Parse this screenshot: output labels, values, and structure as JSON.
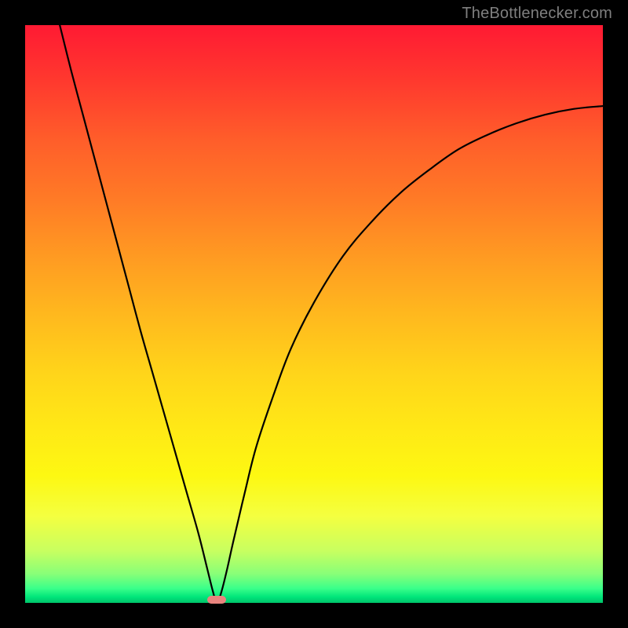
{
  "watermark": "TheBottlenecker.com",
  "colors": {
    "frame": "#000000",
    "watermark": "#7f7f7f",
    "curve": "#000000",
    "marker": "#e8847e",
    "gradient_stops": [
      {
        "pct": 0,
        "hex": "#ff1a33"
      },
      {
        "pct": 10,
        "hex": "#ff3a2e"
      },
      {
        "pct": 20,
        "hex": "#ff5e2a"
      },
      {
        "pct": 30,
        "hex": "#ff7a26"
      },
      {
        "pct": 40,
        "hex": "#ff9a22"
      },
      {
        "pct": 50,
        "hex": "#ffb81e"
      },
      {
        "pct": 60,
        "hex": "#ffd41a"
      },
      {
        "pct": 70,
        "hex": "#ffe916"
      },
      {
        "pct": 78,
        "hex": "#fdf812"
      },
      {
        "pct": 85,
        "hex": "#f4ff40"
      },
      {
        "pct": 91,
        "hex": "#c8ff60"
      },
      {
        "pct": 95,
        "hex": "#88ff78"
      },
      {
        "pct": 97.5,
        "hex": "#3aff8a"
      },
      {
        "pct": 99,
        "hex": "#00e57a"
      },
      {
        "pct": 100,
        "hex": "#00c46a"
      }
    ]
  },
  "chart_data": {
    "type": "line",
    "title": "",
    "xlabel": "",
    "ylabel": "",
    "xlim": [
      0,
      100
    ],
    "ylim": [
      0,
      100
    ],
    "marker": {
      "x": 33.2,
      "y": 0.5
    },
    "series": [
      {
        "name": "bottleneck-curve",
        "points": [
          {
            "x": 6.0,
            "y": 100.0
          },
          {
            "x": 8.0,
            "y": 92.0
          },
          {
            "x": 10.0,
            "y": 84.5
          },
          {
            "x": 12.0,
            "y": 77.0
          },
          {
            "x": 14.0,
            "y": 69.5
          },
          {
            "x": 16.0,
            "y": 62.0
          },
          {
            "x": 18.0,
            "y": 54.5
          },
          {
            "x": 20.0,
            "y": 47.0
          },
          {
            "x": 22.0,
            "y": 40.0
          },
          {
            "x": 24.0,
            "y": 33.0
          },
          {
            "x": 26.0,
            "y": 26.0
          },
          {
            "x": 28.0,
            "y": 19.0
          },
          {
            "x": 30.0,
            "y": 12.0
          },
          {
            "x": 31.5,
            "y": 6.0
          },
          {
            "x": 32.5,
            "y": 2.0
          },
          {
            "x": 33.2,
            "y": 0.0
          },
          {
            "x": 34.0,
            "y": 2.0
          },
          {
            "x": 35.0,
            "y": 6.0
          },
          {
            "x": 36.0,
            "y": 10.5
          },
          {
            "x": 38.0,
            "y": 19.0
          },
          {
            "x": 40.0,
            "y": 27.0
          },
          {
            "x": 43.0,
            "y": 36.0
          },
          {
            "x": 46.0,
            "y": 44.0
          },
          {
            "x": 50.0,
            "y": 52.0
          },
          {
            "x": 55.0,
            "y": 60.0
          },
          {
            "x": 60.0,
            "y": 66.0
          },
          {
            "x": 65.0,
            "y": 71.0
          },
          {
            "x": 70.0,
            "y": 75.0
          },
          {
            "x": 75.0,
            "y": 78.5
          },
          {
            "x": 80.0,
            "y": 81.0
          },
          {
            "x": 85.0,
            "y": 83.0
          },
          {
            "x": 90.0,
            "y": 84.5
          },
          {
            "x": 95.0,
            "y": 85.5
          },
          {
            "x": 100.0,
            "y": 86.0
          }
        ]
      }
    ]
  }
}
